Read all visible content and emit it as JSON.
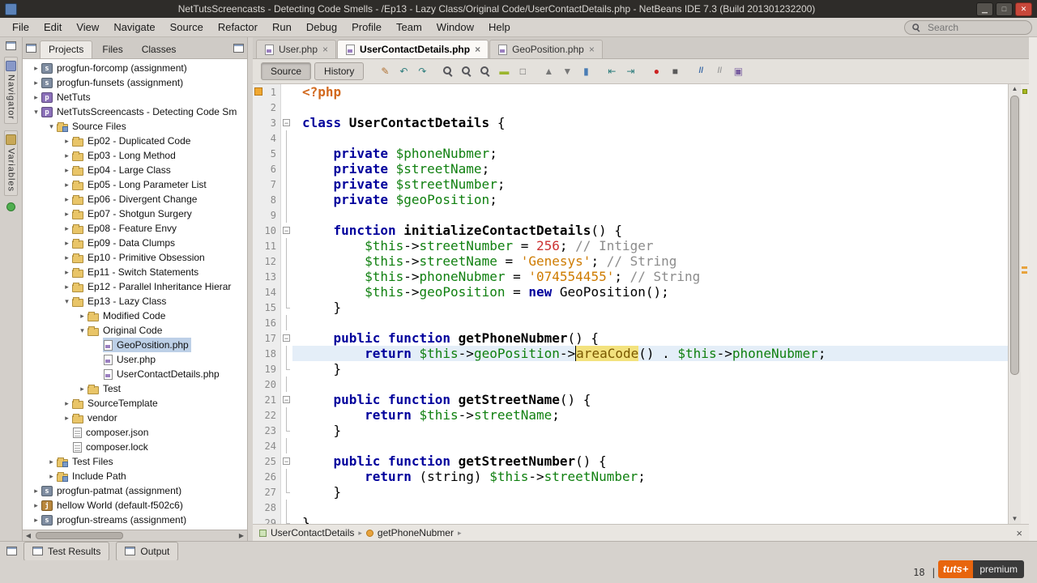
{
  "titlebar": {
    "title": "NetTutsScreencasts - Detecting Code Smells - /Ep13 - Lazy Class/Original Code/UserContactDetails.php - NetBeans IDE 7.3 (Build 201301232200)",
    "controls": [
      {
        "name": "minimize-button",
        "glyph": "▁"
      },
      {
        "name": "maximize-button",
        "glyph": "□"
      },
      {
        "name": "close-button",
        "glyph": "✕"
      }
    ]
  },
  "menubar": {
    "items": [
      "File",
      "Edit",
      "View",
      "Navigate",
      "Source",
      "Refactor",
      "Run",
      "Debug",
      "Profile",
      "Team",
      "Window",
      "Help"
    ],
    "search_placeholder": "Search"
  },
  "left_dock": {
    "tabs": [
      {
        "label": "Navigator"
      },
      {
        "label": "Variables"
      }
    ]
  },
  "explorer": {
    "tabs": [
      {
        "label": "Projects",
        "active": true
      },
      {
        "label": "Files",
        "active": false
      },
      {
        "label": "Classes",
        "active": false
      }
    ],
    "tree": [
      {
        "label": "progfun-forcomp (assignment)",
        "depth": 0,
        "icon": "project-scala",
        "handle": "collapsed"
      },
      {
        "label": "progfun-funsets (assignment)",
        "depth": 0,
        "icon": "project-scala",
        "handle": "collapsed"
      },
      {
        "label": "NetTuts",
        "depth": 0,
        "icon": "project-php",
        "handle": "collapsed"
      },
      {
        "label": "NetTutsScreencasts - Detecting Code Sm",
        "depth": 0,
        "icon": "project-php",
        "handle": "expanded"
      },
      {
        "label": "Source Files",
        "depth": 1,
        "icon": "folder-badge",
        "handle": "expanded"
      },
      {
        "label": "Ep02 - Duplicated Code",
        "depth": 2,
        "icon": "folder",
        "handle": "collapsed"
      },
      {
        "label": "Ep03 - Long Method",
        "depth": 2,
        "icon": "folder",
        "handle": "collapsed"
      },
      {
        "label": "Ep04 - Large Class",
        "depth": 2,
        "icon": "folder",
        "handle": "collapsed"
      },
      {
        "label": "Ep05 - Long Parameter List",
        "depth": 2,
        "icon": "folder",
        "handle": "collapsed"
      },
      {
        "label": "Ep06 - Divergent Change",
        "depth": 2,
        "icon": "folder",
        "handle": "collapsed"
      },
      {
        "label": "Ep07 - Shotgun Surgery",
        "depth": 2,
        "icon": "folder",
        "handle": "collapsed"
      },
      {
        "label": "Ep08 - Feature Envy",
        "depth": 2,
        "icon": "folder",
        "handle": "collapsed"
      },
      {
        "label": "Ep09 - Data Clumps",
        "depth": 2,
        "icon": "folder",
        "handle": "collapsed"
      },
      {
        "label": "Ep10 - Primitive Obsession",
        "depth": 2,
        "icon": "folder",
        "handle": "collapsed"
      },
      {
        "label": "Ep11 - Switch Statements",
        "depth": 2,
        "icon": "folder",
        "handle": "collapsed"
      },
      {
        "label": "Ep12 - Parallel Inheritance Hierar",
        "depth": 2,
        "icon": "folder",
        "handle": "collapsed"
      },
      {
        "label": "Ep13 - Lazy Class",
        "depth": 2,
        "icon": "folder",
        "handle": "expanded"
      },
      {
        "label": "Modified Code",
        "depth": 3,
        "icon": "folder",
        "handle": "collapsed"
      },
      {
        "label": "Original Code",
        "depth": 3,
        "icon": "folder",
        "handle": "expanded"
      },
      {
        "label": "GeoPosition.php",
        "depth": 4,
        "icon": "php-file",
        "handle": "none",
        "selected": true
      },
      {
        "label": "User.php",
        "depth": 4,
        "icon": "php-file",
        "handle": "none"
      },
      {
        "label": "UserContactDetails.php",
        "depth": 4,
        "icon": "php-file",
        "handle": "none"
      },
      {
        "label": "Test",
        "depth": 3,
        "icon": "folder",
        "handle": "collapsed"
      },
      {
        "label": "SourceTemplate",
        "depth": 2,
        "icon": "folder",
        "handle": "collapsed"
      },
      {
        "label": "vendor",
        "depth": 2,
        "icon": "folder",
        "handle": "collapsed"
      },
      {
        "label": "composer.json",
        "depth": 2,
        "icon": "file",
        "handle": "none"
      },
      {
        "label": "composer.lock",
        "depth": 2,
        "icon": "file",
        "handle": "none"
      },
      {
        "label": "Test Files",
        "depth": 1,
        "icon": "folder-badge",
        "handle": "collapsed"
      },
      {
        "label": "Include Path",
        "depth": 1,
        "icon": "folder-badge",
        "handle": "collapsed"
      },
      {
        "label": "progfun-patmat (assignment)",
        "depth": 0,
        "icon": "project-scala",
        "handle": "collapsed"
      },
      {
        "label": "hellow World (default-f502c6)",
        "depth": 0,
        "icon": "project-java",
        "handle": "collapsed"
      },
      {
        "label": "progfun-streams (assignment)",
        "depth": 0,
        "icon": "project-scala",
        "handle": "collapsed"
      }
    ]
  },
  "editor": {
    "tabs": [
      {
        "label": "User.php",
        "active": false,
        "close": "×"
      },
      {
        "label": "UserContactDetails.php",
        "active": true,
        "close": "×"
      },
      {
        "label": "GeoPosition.php",
        "active": false,
        "close": "×"
      }
    ],
    "toolbar": {
      "source_label": "Source",
      "history_label": "History",
      "groups": [
        [
          {
            "name": "last-edit-icon",
            "glyph": "✎",
            "color": "#B07030"
          },
          {
            "name": "back-icon",
            "glyph": "↶",
            "color": "#2E7D7D"
          },
          {
            "name": "forward-icon",
            "glyph": "↷",
            "color": "#2E7D7D"
          }
        ],
        [
          {
            "name": "find-selection-icon",
            "shape": "magnifier"
          },
          {
            "name": "find-previous-icon",
            "shape": "magnifier"
          },
          {
            "name": "find-next-icon",
            "shape": "magnifier"
          },
          {
            "name": "toggle-highlight-search-icon",
            "glyph": "▬",
            "color": "#9BB52D"
          },
          {
            "name": "toggle-rectangular-selection-icon",
            "glyph": "□",
            "color": "#666666"
          }
        ],
        [
          {
            "name": "previous-bookmark-icon",
            "glyph": "▲",
            "color": "#777777"
          },
          {
            "name": "next-bookmark-icon",
            "glyph": "▼",
            "color": "#777777"
          },
          {
            "name": "toggle-bookmark-icon",
            "glyph": "▮",
            "color": "#4A7DB5"
          }
        ],
        [
          {
            "name": "shift-line-left-icon",
            "glyph": "⇤",
            "color": "#2E7D7D"
          },
          {
            "name": "shift-line-right-icon",
            "glyph": "⇥",
            "color": "#2E7D7D"
          }
        ],
        [
          {
            "name": "start-macro-recording-icon",
            "glyph": "●",
            "color": "#CC2222"
          },
          {
            "name": "stop-macro-recording-icon",
            "glyph": "■",
            "color": "#5A5A5A"
          }
        ],
        [
          {
            "name": "comment-icon",
            "glyph": "//",
            "color": "#3465A4",
            "small": true
          },
          {
            "name": "uncomment-icon",
            "glyph": "//",
            "color": "#9A9A9A",
            "small": true
          },
          {
            "name": "inspect-members-icon",
            "glyph": "▣",
            "color": "#7A5FA0"
          }
        ]
      ]
    },
    "code": {
      "lines": [
        {
          "n": 1,
          "annot": true,
          "segs": [
            [
              "<?php",
              "tag"
            ]
          ]
        },
        {
          "n": 2,
          "segs": []
        },
        {
          "n": 3,
          "fold": "box",
          "segs": [
            [
              "class ",
              "kw"
            ],
            [
              "UserContactDetails",
              "name"
            ],
            [
              " {",
              "pln"
            ]
          ]
        },
        {
          "n": 4,
          "fold": "line",
          "segs": []
        },
        {
          "n": 5,
          "fold": "line",
          "segs": [
            [
              "    ",
              "pln"
            ],
            [
              "private ",
              "kw"
            ],
            [
              "$phoneNubmer",
              "var"
            ],
            [
              ";",
              "pln"
            ]
          ]
        },
        {
          "n": 6,
          "fold": "line",
          "segs": [
            [
              "    ",
              "pln"
            ],
            [
              "private ",
              "kw"
            ],
            [
              "$streetName",
              "var"
            ],
            [
              ";",
              "pln"
            ]
          ]
        },
        {
          "n": 7,
          "fold": "line",
          "segs": [
            [
              "    ",
              "pln"
            ],
            [
              "private ",
              "kw"
            ],
            [
              "$streetNumber",
              "var"
            ],
            [
              ";",
              "pln"
            ]
          ]
        },
        {
          "n": 8,
          "fold": "line",
          "segs": [
            [
              "    ",
              "pln"
            ],
            [
              "private ",
              "kw"
            ],
            [
              "$geoPosition",
              "var"
            ],
            [
              ";",
              "pln"
            ]
          ]
        },
        {
          "n": 9,
          "fold": "line",
          "segs": []
        },
        {
          "n": 10,
          "fold": "box",
          "segs": [
            [
              "    ",
              "pln"
            ],
            [
              "function ",
              "kw"
            ],
            [
              "initializeContactDetails",
              "name"
            ],
            [
              "() {",
              "pln"
            ]
          ]
        },
        {
          "n": 11,
          "fold": "line",
          "segs": [
            [
              "        ",
              "pln"
            ],
            [
              "$this",
              "var"
            ],
            [
              "->",
              "pln"
            ],
            [
              "streetNumber",
              "var"
            ],
            [
              " = ",
              "pln"
            ],
            [
              "256",
              "num"
            ],
            [
              "; ",
              "pln"
            ],
            [
              "// Intiger",
              "com"
            ]
          ]
        },
        {
          "n": 12,
          "fold": "line",
          "segs": [
            [
              "        ",
              "pln"
            ],
            [
              "$this",
              "var"
            ],
            [
              "->",
              "pln"
            ],
            [
              "streetName",
              "var"
            ],
            [
              " = ",
              "pln"
            ],
            [
              "'Genesys'",
              "str"
            ],
            [
              "; ",
              "pln"
            ],
            [
              "// String",
              "com"
            ]
          ]
        },
        {
          "n": 13,
          "fold": "line",
          "segs": [
            [
              "        ",
              "pln"
            ],
            [
              "$this",
              "var"
            ],
            [
              "->",
              "pln"
            ],
            [
              "phoneNubmer",
              "var"
            ],
            [
              " = ",
              "pln"
            ],
            [
              "'074554455'",
              "str"
            ],
            [
              "; ",
              "pln"
            ],
            [
              "// String",
              "com"
            ]
          ]
        },
        {
          "n": 14,
          "fold": "line",
          "segs": [
            [
              "        ",
              "pln"
            ],
            [
              "$this",
              "var"
            ],
            [
              "->",
              "pln"
            ],
            [
              "geoPosition",
              "var"
            ],
            [
              " = ",
              "pln"
            ],
            [
              "new ",
              "kw"
            ],
            [
              "GeoPosition();",
              "pln"
            ]
          ]
        },
        {
          "n": 15,
          "fold": "end",
          "segs": [
            [
              "    }",
              "pln"
            ]
          ]
        },
        {
          "n": 16,
          "fold": "line",
          "segs": []
        },
        {
          "n": 17,
          "fold": "box",
          "segs": [
            [
              "    ",
              "pln"
            ],
            [
              "public function ",
              "kw"
            ],
            [
              "getPhoneNubmer",
              "name"
            ],
            [
              "() {",
              "pln"
            ]
          ]
        },
        {
          "n": 18,
          "fold": "line",
          "current": true,
          "segs": [
            [
              "        ",
              "pln"
            ],
            [
              "return ",
              "kw"
            ],
            [
              "$this",
              "var"
            ],
            [
              "->",
              "pln"
            ],
            [
              "geoPosition",
              "var"
            ],
            [
              "->",
              "pln"
            ],
            [
              "areaCode",
              "hl"
            ],
            [
              "() . ",
              "pln"
            ],
            [
              "$this",
              "var"
            ],
            [
              "->",
              "pln"
            ],
            [
              "phoneNubmer",
              "var"
            ],
            [
              ";",
              "pln"
            ]
          ]
        },
        {
          "n": 19,
          "fold": "end",
          "segs": [
            [
              "    }",
              "pln"
            ]
          ]
        },
        {
          "n": 20,
          "fold": "line",
          "segs": []
        },
        {
          "n": 21,
          "fold": "box",
          "segs": [
            [
              "    ",
              "pln"
            ],
            [
              "public function ",
              "kw"
            ],
            [
              "getStreetName",
              "name"
            ],
            [
              "() {",
              "pln"
            ]
          ]
        },
        {
          "n": 22,
          "fold": "line",
          "segs": [
            [
              "        ",
              "pln"
            ],
            [
              "return ",
              "kw"
            ],
            [
              "$this",
              "var"
            ],
            [
              "->",
              "pln"
            ],
            [
              "streetName",
              "var"
            ],
            [
              ";",
              "pln"
            ]
          ]
        },
        {
          "n": 23,
          "fold": "end",
          "segs": [
            [
              "    }",
              "pln"
            ]
          ]
        },
        {
          "n": 24,
          "fold": "line",
          "segs": []
        },
        {
          "n": 25,
          "fold": "box",
          "segs": [
            [
              "    ",
              "pln"
            ],
            [
              "public function ",
              "kw"
            ],
            [
              "getStreetNumber",
              "name"
            ],
            [
              "() {",
              "pln"
            ]
          ]
        },
        {
          "n": 26,
          "fold": "line",
          "segs": [
            [
              "        ",
              "pln"
            ],
            [
              "return ",
              "kw"
            ],
            [
              "(string) ",
              "pln"
            ],
            [
              "$this",
              "var"
            ],
            [
              "->",
              "pln"
            ],
            [
              "streetNumber",
              "var"
            ],
            [
              ";",
              "pln"
            ]
          ]
        },
        {
          "n": 27,
          "fold": "end",
          "segs": [
            [
              "    }",
              "pln"
            ]
          ]
        },
        {
          "n": 28,
          "fold": "line",
          "segs": []
        },
        {
          "n": 29,
          "fold": "end",
          "segs": [
            [
              "}",
              "pln"
            ]
          ]
        }
      ]
    },
    "breadcrumb": {
      "items": [
        {
          "label": "UserContactDetails",
          "icon": "class"
        },
        {
          "label": "getPhoneNubmer",
          "icon": "method"
        }
      ],
      "separator": "▸",
      "close_label": "×"
    }
  },
  "bottom": {
    "tabs": [
      {
        "label": "Test Results"
      },
      {
        "label": "Output"
      }
    ],
    "status_right": "18 |"
  },
  "watermark": {
    "left": "tuts+",
    "right": "premium"
  }
}
